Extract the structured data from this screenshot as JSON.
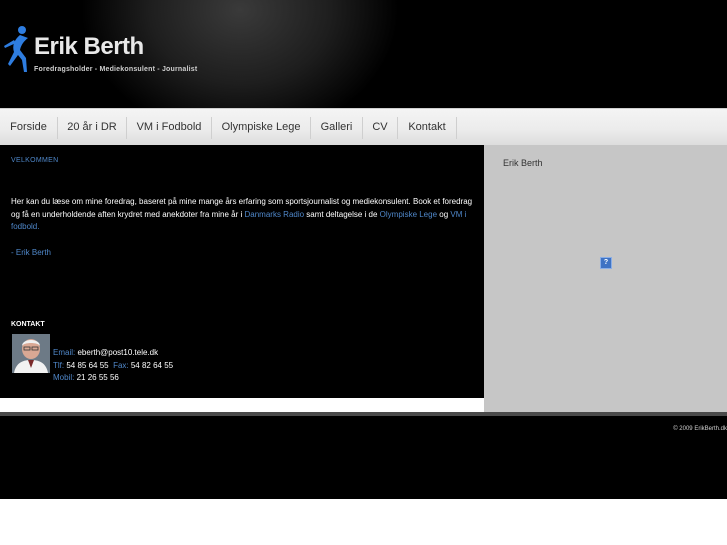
{
  "header": {
    "name": "Erik Berth",
    "tagline": "Foredragsholder - Mediekonsulent - Journalist",
    "logo_icon": "runner-figure-icon"
  },
  "nav": {
    "items": [
      {
        "label": "Forside"
      },
      {
        "label": "20 år i DR"
      },
      {
        "label": "VM i Fodbold"
      },
      {
        "label": "Olympiske Lege"
      },
      {
        "label": "Galleri"
      },
      {
        "label": "CV"
      },
      {
        "label": "Kontakt"
      }
    ]
  },
  "welcome": {
    "heading": "VELKOMMEN",
    "text_1": "Her kan du læse om mine foredrag, baseret på mine mange års erfaring som sportsjournalist og mediekonsulent.  Book et foredrag og få en underholdende aften krydret med anekdoter fra mine år i ",
    "link_dr": "Danmarks Radio",
    "text_2": " samt deltagelse i de ",
    "link_ol": "Olympiske Lege",
    "text_3": " og ",
    "link_vm": "VM i fodbold.",
    "signature": "- Erik Berth"
  },
  "contact": {
    "heading": "KONTAKT",
    "email_label": "Email:",
    "email": "eberth@post10.tele.dk",
    "tlf_label": "Tlf:",
    "tlf": "54 85 64 55",
    "fax_label": "Fax:",
    "fax": "54 82 64 55",
    "mobil_label": "Mobil:",
    "mobil": "21 26 55 56"
  },
  "sidebar": {
    "name": "Erik Berth",
    "image_icon": "broken-image-icon",
    "image_glyph": "?"
  },
  "footer": {
    "copyright": "© 2009",
    "site_link": "ErikBerth.dk"
  },
  "colors": {
    "link": "#4f87c9",
    "background": "#000000",
    "sidebar": "#c6c6c6"
  }
}
